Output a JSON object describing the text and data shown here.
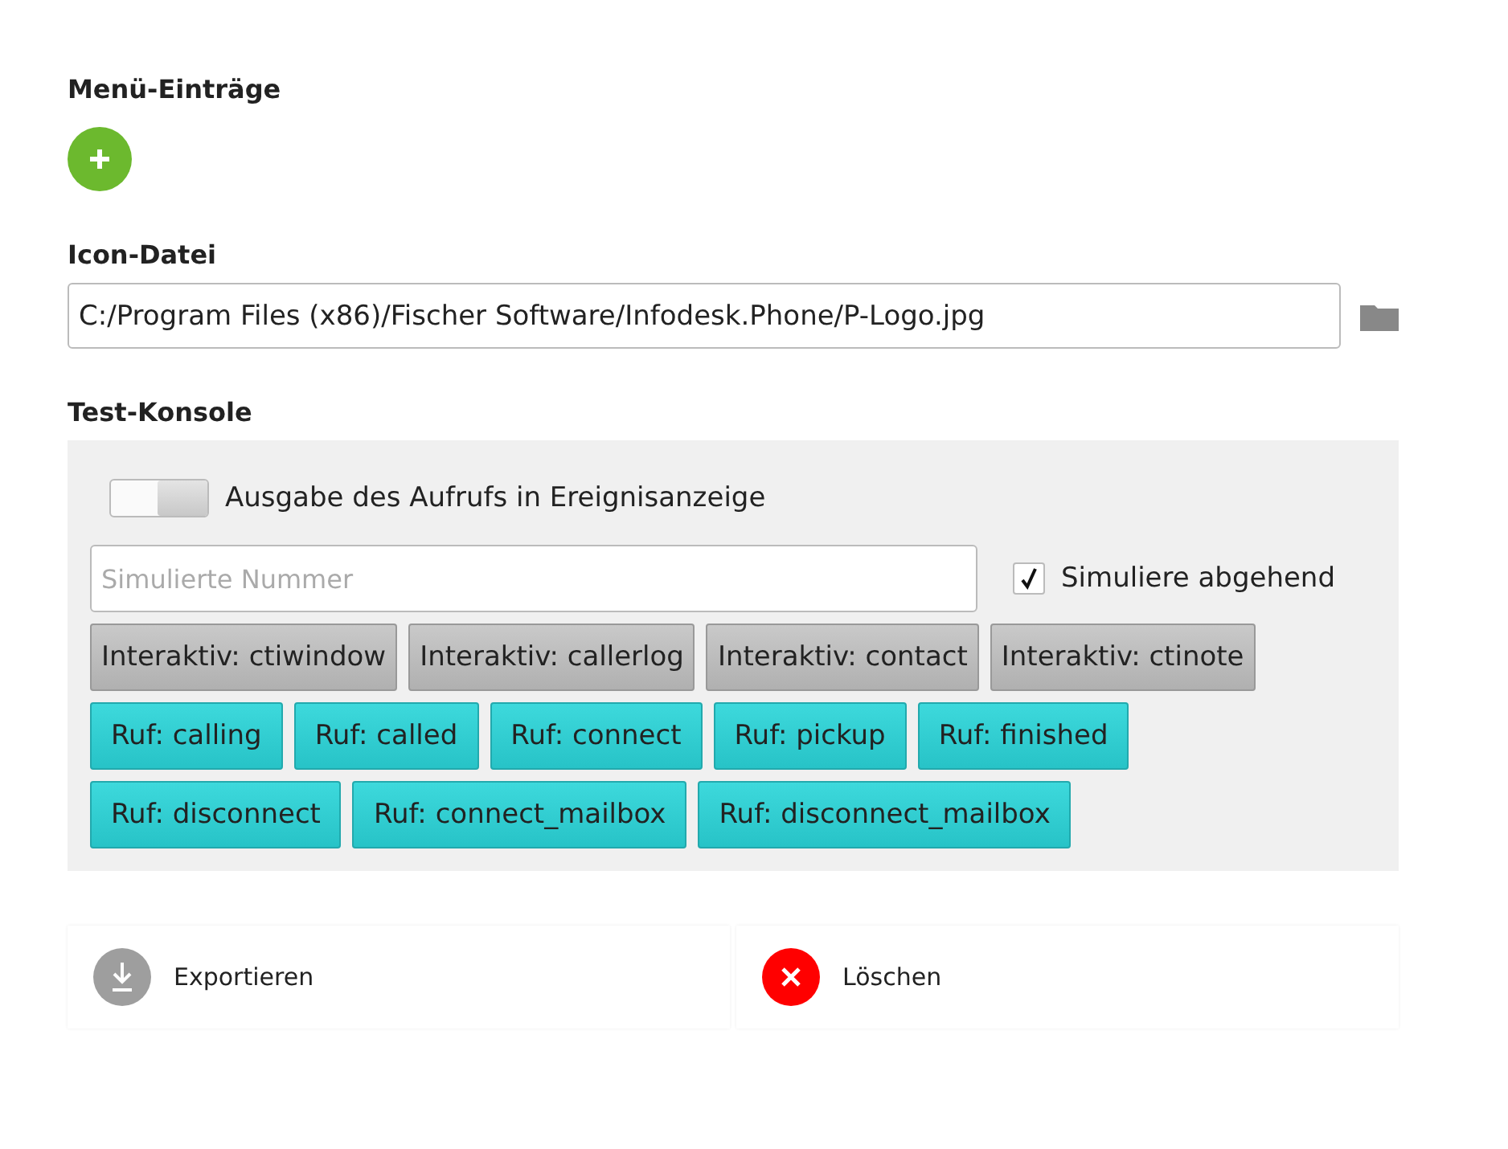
{
  "menu_entries": {
    "title": "Menü-Einträge"
  },
  "icon_file": {
    "label": "Icon-Datei",
    "value": "C:/Program Files (x86)/Fischer Software/Infodesk.Phone/P-Logo.jpg"
  },
  "test_console": {
    "title": "Test-Konsole",
    "toggle": {
      "label": "Ausgabe des Aufrufs in Ereignisanzeige",
      "on": false
    },
    "number_field": {
      "placeholder": "Simulierte Nummer"
    },
    "checkbox": {
      "label": "Simuliere abgehend",
      "checked": true
    },
    "button_rows": [
      [
        {
          "label": "Interaktiv: ctiwindow",
          "kind": "interactive"
        },
        {
          "label": "Interaktiv: callerlog",
          "kind": "interactive"
        },
        {
          "label": "Interaktiv: contact",
          "kind": "interactive"
        },
        {
          "label": "Interaktiv: ctinote",
          "kind": "interactive"
        }
      ],
      [
        {
          "label": "Ruf: calling",
          "kind": "call"
        },
        {
          "label": "Ruf: called",
          "kind": "call"
        },
        {
          "label": "Ruf: connect",
          "kind": "call"
        },
        {
          "label": "Ruf: pickup",
          "kind": "call"
        },
        {
          "label": "Ruf: finished",
          "kind": "call"
        }
      ],
      [
        {
          "label": "Ruf: disconnect",
          "kind": "call"
        },
        {
          "label": "Ruf: connect_mailbox",
          "kind": "call"
        },
        {
          "label": "Ruf: disconnect_mailbox",
          "kind": "call"
        }
      ]
    ]
  },
  "actions": [
    {
      "label": "Exportieren",
      "kind": "export"
    },
    {
      "label": "Löschen",
      "kind": "delete"
    }
  ]
}
